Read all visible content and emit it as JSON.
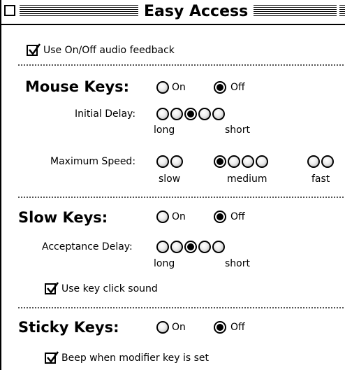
{
  "window": {
    "title": "Easy Access"
  },
  "audio_feedback": {
    "label": "Use On/Off audio feedback",
    "checked": true
  },
  "mouse_keys": {
    "heading": "Mouse Keys:",
    "on_label": "On",
    "off_label": "Off",
    "selected": "off",
    "initial_delay": {
      "label": "Initial Delay:",
      "left_label": "long",
      "right_label": "short",
      "steps": 5,
      "selected_index": 2
    },
    "maximum_speed": {
      "label": "Maximum Speed:",
      "slow_label": "slow",
      "medium_label": "medium",
      "fast_label": "fast",
      "steps": 8,
      "selected_index": 2
    }
  },
  "slow_keys": {
    "heading": "Slow Keys:",
    "on_label": "On",
    "off_label": "Off",
    "selected": "off",
    "acceptance_delay": {
      "label": "Acceptance Delay:",
      "left_label": "long",
      "right_label": "short",
      "steps": 5,
      "selected_index": 2
    },
    "key_click_sound": {
      "label": "Use key click sound",
      "checked": true
    }
  },
  "sticky_keys": {
    "heading": "Sticky Keys:",
    "on_label": "On",
    "off_label": "Off",
    "selected": "off",
    "beep_modifier": {
      "label": "Beep when modifier key is set",
      "checked": true
    }
  }
}
